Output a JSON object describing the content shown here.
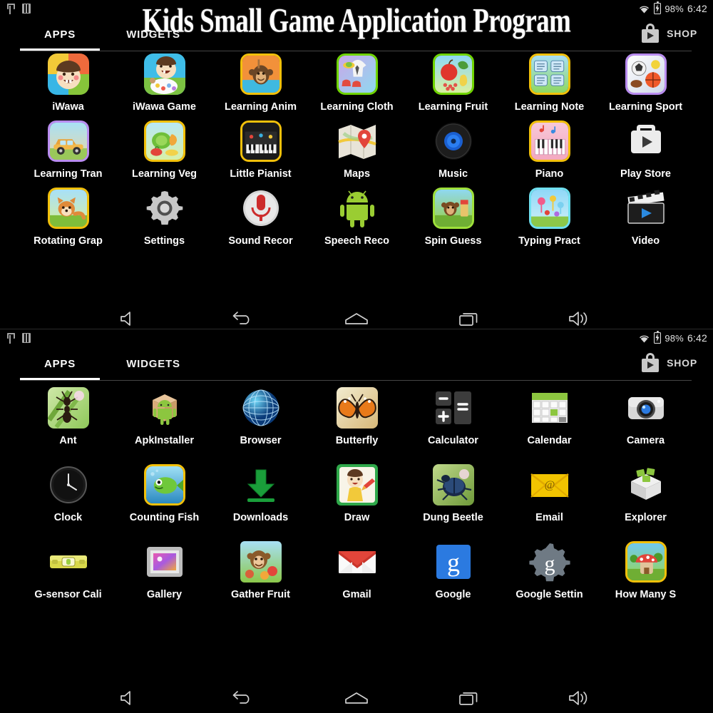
{
  "overlay_title": "Kids Small Game Application Program",
  "statusbar": {
    "usb_icon": "usb-icon",
    "sdcard_icon": "sdcard-icon",
    "wifi_icon": "wifi-icon",
    "battery_icon": "battery-charging-icon",
    "battery_percent": "98%",
    "time": "6:42"
  },
  "header": {
    "tab_apps": "APPS",
    "tab_widgets": "WIDGETS",
    "shop_label": "SHOP",
    "shop_icon": "play-store-bag-icon",
    "active_tab": "APPS"
  },
  "navbar": {
    "volume_down": "volume-down-icon",
    "back": "back-icon",
    "home": "home-icon",
    "recents": "recents-icon",
    "volume_up": "volume-up-icon"
  },
  "colors": {
    "background": "#000000",
    "text": "#ffffff",
    "tab_underline": "#ffffff",
    "divider": "#454545",
    "status_text": "#e2e2e2"
  },
  "page_top": {
    "apps": [
      {
        "label": "iWawa",
        "icon": "iwawa-icon",
        "frame": "none",
        "kind": "face-rainbow"
      },
      {
        "label": "iWawa Game",
        "icon": "iwawa-game-icon",
        "frame": "none",
        "kind": "face-painter"
      },
      {
        "label": "Learning Anim",
        "icon": "learning-animal-icon",
        "frame": "gold",
        "kind": "art-monkey"
      },
      {
        "label": "Learning Cloth",
        "icon": "learning-cloth-icon",
        "frame": "green",
        "kind": "art-cloth"
      },
      {
        "label": "Learning Fruit",
        "icon": "learning-fruit-icon",
        "frame": "green",
        "kind": "art-fruit"
      },
      {
        "label": "Learning Note",
        "icon": "learning-note-icon",
        "frame": "gold",
        "kind": "art-note"
      },
      {
        "label": "Learning Sport",
        "icon": "learning-sport-icon",
        "frame": "purple",
        "kind": "art-sport"
      },
      {
        "label": "Learning Tran",
        "icon": "learning-transport-icon",
        "frame": "purple",
        "kind": "art-car"
      },
      {
        "label": "Learning Veg",
        "icon": "learning-veg-icon",
        "frame": "gold",
        "kind": "art-veg"
      },
      {
        "label": "Little Pianist",
        "icon": "little-pianist-icon",
        "frame": "gold",
        "kind": "art-piano-dark"
      },
      {
        "label": "Maps",
        "icon": "maps-icon",
        "frame": "none",
        "kind": "maps"
      },
      {
        "label": "Music",
        "icon": "music-icon",
        "frame": "none",
        "kind": "music"
      },
      {
        "label": "Piano",
        "icon": "piano-icon",
        "frame": "gold",
        "kind": "art-piano"
      },
      {
        "label": "Play Store",
        "icon": "play-store-icon",
        "frame": "none",
        "kind": "playstore"
      },
      {
        "label": "Rotating Grap",
        "icon": "rotating-graphic-icon",
        "frame": "gold",
        "kind": "art-fox"
      },
      {
        "label": "Settings",
        "icon": "settings-icon",
        "frame": "none",
        "kind": "settings"
      },
      {
        "label": "Sound Recor",
        "icon": "sound-recorder-icon",
        "frame": "none",
        "kind": "recorder"
      },
      {
        "label": "Speech Reco",
        "icon": "speech-recorder-icon",
        "frame": "none",
        "kind": "android"
      },
      {
        "label": "Spin Guess",
        "icon": "spin-guess-icon",
        "frame": "ltgreen",
        "kind": "art-spin"
      },
      {
        "label": "Typing Pract",
        "icon": "typing-practice-icon",
        "frame": "cyan",
        "kind": "art-typing"
      },
      {
        "label": "Video",
        "icon": "video-icon",
        "frame": "none",
        "kind": "video"
      }
    ]
  },
  "page_bottom": {
    "apps": [
      {
        "label": "Ant",
        "icon": "ant-icon",
        "frame": "none",
        "kind": "photo-ant"
      },
      {
        "label": "ApkInstaller",
        "icon": "apkinstaller-icon",
        "frame": "none",
        "kind": "apkbox"
      },
      {
        "label": "Browser",
        "icon": "browser-icon",
        "frame": "none",
        "kind": "globe"
      },
      {
        "label": "Butterfly",
        "icon": "butterfly-icon",
        "frame": "none",
        "kind": "photo-butterfly"
      },
      {
        "label": "Calculator",
        "icon": "calculator-icon",
        "frame": "none",
        "kind": "calculator"
      },
      {
        "label": "Calendar",
        "icon": "calendar-icon",
        "frame": "none",
        "kind": "calendar"
      },
      {
        "label": "Camera",
        "icon": "camera-icon",
        "frame": "none",
        "kind": "camera"
      },
      {
        "label": "Clock",
        "icon": "clock-icon",
        "frame": "none",
        "kind": "clock"
      },
      {
        "label": "Counting Fish",
        "icon": "counting-fish-icon",
        "frame": "gold",
        "kind": "art-fish"
      },
      {
        "label": "Downloads",
        "icon": "downloads-icon",
        "frame": "none",
        "kind": "download"
      },
      {
        "label": "Draw",
        "icon": "draw-icon",
        "frame": "none",
        "kind": "art-draw"
      },
      {
        "label": "Dung Beetle",
        "icon": "dung-beetle-icon",
        "frame": "none",
        "kind": "photo-beetle"
      },
      {
        "label": "Email",
        "icon": "email-icon",
        "frame": "none",
        "kind": "email"
      },
      {
        "label": "Explorer",
        "icon": "explorer-icon",
        "frame": "none",
        "kind": "explorer"
      },
      {
        "label": "G-sensor Cali",
        "icon": "g-sensor-calibration-icon",
        "frame": "none",
        "kind": "level"
      },
      {
        "label": "Gallery",
        "icon": "gallery-icon",
        "frame": "none",
        "kind": "gallery"
      },
      {
        "label": "Gather Fruit",
        "icon": "gather-fruit-icon",
        "frame": "none",
        "kind": "art-monkey2"
      },
      {
        "label": "Gmail",
        "icon": "gmail-icon",
        "frame": "none",
        "kind": "gmail"
      },
      {
        "label": "Google",
        "icon": "google-icon",
        "frame": "none",
        "kind": "google"
      },
      {
        "label": "Google Settin",
        "icon": "google-settings-icon",
        "frame": "none",
        "kind": "gsettings"
      },
      {
        "label": "How Many S",
        "icon": "how-many-icon",
        "frame": "gold",
        "kind": "art-mushroom"
      }
    ]
  }
}
